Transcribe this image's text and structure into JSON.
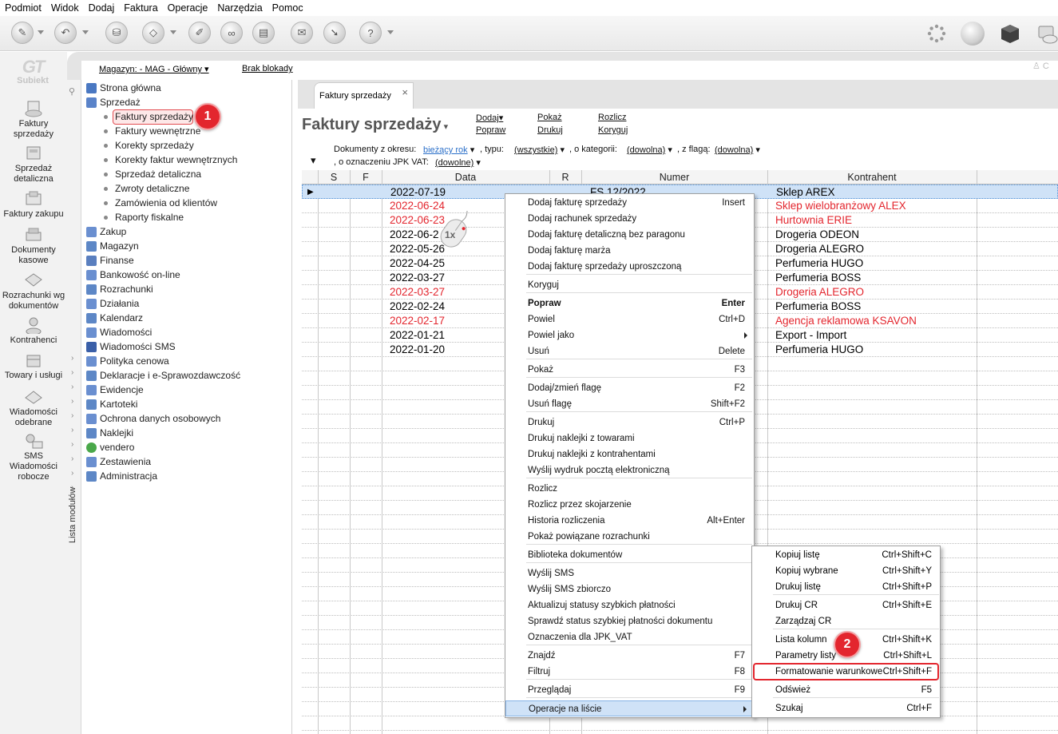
{
  "menubar": [
    "Podmiot",
    "Widok",
    "Dodaj",
    "Faktura",
    "Operacje",
    "Narzędzia",
    "Pomoc"
  ],
  "logo": {
    "mark": "GT",
    "text": "Subiekt"
  },
  "leftbar": [
    {
      "label": "Faktury sprzedaży",
      "icon": "invoices-icon"
    },
    {
      "label": "Sprzedaż detaliczna",
      "icon": "retail-icon"
    },
    {
      "label": "Faktury zakupu",
      "icon": "purchase-icon"
    },
    {
      "label": "Dokumenty kasowe",
      "icon": "cash-docs-icon"
    },
    {
      "label": "Rozrachunki wg dokumentów",
      "icon": "settlements-icon"
    },
    {
      "label": "Kontrahenci",
      "icon": "contractors-icon"
    },
    {
      "label": "Towary i usługi",
      "icon": "goods-icon"
    },
    {
      "label": "Wiadomości odebrane",
      "icon": "messages-icon"
    },
    {
      "label": "SMS Wiadomości robocze",
      "icon": "sms-icon"
    }
  ],
  "header": {
    "warehouse": "Magazyn: - MAG - Główny",
    "lock": "Brak blokady",
    "user_initial": "C"
  },
  "modules_label": "Lista modułów",
  "tree": {
    "items": [
      {
        "label": "Strona główna",
        "color": "#4a78c2"
      },
      {
        "label": "Sprzedaż",
        "color": "#5a83c9"
      }
    ],
    "sales_children": [
      "Faktury sprzedaży",
      "Faktury wewnętrzne",
      "Korekty sprzedaży",
      "Korekty faktur wewnętrznych",
      "Sprzedaż detaliczna",
      "Zwroty detaliczne",
      "Zamówienia od klientów",
      "Raporty fiskalne"
    ],
    "rest": [
      {
        "label": "Zakup",
        "color": "#6a8fd0"
      },
      {
        "label": "Magazyn",
        "color": "#5d87c6"
      },
      {
        "label": "Finanse",
        "color": "#5a7fbf"
      },
      {
        "label": "Bankowość on-line",
        "color": "#6a8fd0"
      },
      {
        "label": "Rozrachunki",
        "color": "#5d87c6"
      },
      {
        "label": "Działania",
        "color": "#6a8fd0"
      },
      {
        "label": "Kalendarz",
        "color": "#5d87c6"
      },
      {
        "label": "Wiadomości",
        "color": "#6a8fd0"
      },
      {
        "label": "Wiadomości SMS",
        "color": "#3a5fa8"
      },
      {
        "label": "Polityka cenowa",
        "color": "#6a8fd0"
      },
      {
        "label": "Deklaracje i e-Sprawozdawczość",
        "color": "#5d87c6"
      },
      {
        "label": "Ewidencje",
        "color": "#6a8fd0"
      },
      {
        "label": "Kartoteki",
        "color": "#5d87c6"
      },
      {
        "label": "Ochrona danych osobowych",
        "color": "#6a8fd0"
      },
      {
        "label": "Naklejki",
        "color": "#5d87c6"
      },
      {
        "label": "vendero",
        "color": "#4aa84a"
      },
      {
        "label": "Zestawienia",
        "color": "#6a8fd0"
      },
      {
        "label": "Administracja",
        "color": "#5d87c6"
      }
    ]
  },
  "badges": {
    "one": "1",
    "two": "2"
  },
  "tab": {
    "label": "Faktury sprzedaży",
    "close": "×"
  },
  "page": {
    "title": "Faktury sprzedaży",
    "actions": [
      "Dodaj",
      "Popraw",
      "Pokaż",
      "Drukuj",
      "Rozlicz",
      "Koryguj"
    ]
  },
  "filters": {
    "period_label": "Dokumenty z okresu:",
    "period_value": "bieżący rok",
    "type_label": ", typu:",
    "type_value": "(wszystkie)",
    "category_label": ", o kategorii:",
    "category_value": "(dowolna)",
    "flag_label": ", z flagą:",
    "flag_value": "(dowolna)",
    "jpk_label": ", o oznaczeniu JPK VAT:",
    "jpk_value": "(dowolne)"
  },
  "columns": [
    "S",
    "F",
    "Data",
    "R",
    "Numer",
    "Kontrahent"
  ],
  "rows": [
    {
      "date": "2022-07-19",
      "number": "FS 12/2022",
      "contractor": "Sklep AREX",
      "red": false
    },
    {
      "date": "2022-06-24",
      "number": "",
      "contractor": "Sklep wielobranżowy  ALEX",
      "red": true
    },
    {
      "date": "2022-06-23",
      "number": "",
      "contractor": "Hurtownia ERIE",
      "red": true
    },
    {
      "date": "2022-06-2",
      "number": "",
      "contractor": "Drogeria ODEON",
      "red": false
    },
    {
      "date": "2022-05-26",
      "number": "",
      "contractor": "Drogeria ALEGRO",
      "red": false
    },
    {
      "date": "2022-04-25",
      "number": "",
      "contractor": "Perfumeria HUGO",
      "red": false
    },
    {
      "date": "2022-03-27",
      "number": "",
      "contractor": "Perfumeria BOSS",
      "red": false
    },
    {
      "date": "2022-03-27",
      "number": "",
      "contractor": "Drogeria ALEGRO",
      "red": true
    },
    {
      "date": "2022-02-24",
      "number": "",
      "contractor": "Perfumeria BOSS",
      "red": false
    },
    {
      "date": "2022-02-17",
      "number": "",
      "contractor": "Agencja reklamowa KSAVON",
      "red": true
    },
    {
      "date": "2022-01-21",
      "number": "",
      "contractor": "Export - Import",
      "red": false
    },
    {
      "date": "2022-01-20",
      "number": "",
      "contractor": "Perfumeria HUGO",
      "red": false
    }
  ],
  "mouse_label": "1x",
  "context_menu": [
    {
      "label": "Dodaj fakturę sprzedaży",
      "shortcut": "Insert"
    },
    {
      "label": "Dodaj rachunek sprzedaży",
      "shortcut": ""
    },
    {
      "label": "Dodaj fakturę detaliczną bez paragonu",
      "shortcut": ""
    },
    {
      "label": "Dodaj fakturę marża",
      "shortcut": ""
    },
    {
      "label": "Dodaj fakturę sprzedaży uproszczoną",
      "shortcut": ""
    },
    {
      "label": "Koryguj",
      "shortcut": ""
    },
    {
      "label": "Popraw",
      "shortcut": "Enter"
    },
    {
      "label": "Powiel",
      "shortcut": "Ctrl+D"
    },
    {
      "label": "Powiel jako",
      "shortcut": ""
    },
    {
      "label": "Usuń",
      "shortcut": "Delete"
    },
    {
      "label": "Pokaż",
      "shortcut": "F3"
    },
    {
      "label": "Dodaj/zmień flagę",
      "shortcut": "F2"
    },
    {
      "label": "Usuń flagę",
      "shortcut": "Shift+F2"
    },
    {
      "label": "Drukuj",
      "shortcut": "Ctrl+P"
    },
    {
      "label": "Drukuj naklejki z towarami",
      "shortcut": ""
    },
    {
      "label": "Drukuj naklejki z kontrahentami",
      "shortcut": ""
    },
    {
      "label": "Wyślij wydruk pocztą elektroniczną",
      "shortcut": ""
    },
    {
      "label": "Rozlicz",
      "shortcut": ""
    },
    {
      "label": "Rozlicz przez skojarzenie",
      "shortcut": ""
    },
    {
      "label": "Historia rozliczenia",
      "shortcut": "Alt+Enter"
    },
    {
      "label": "Pokaż powiązane rozrachunki",
      "shortcut": ""
    },
    {
      "label": "Biblioteka dokumentów",
      "shortcut": ""
    },
    {
      "label": "Wyślij SMS",
      "shortcut": ""
    },
    {
      "label": "Wyślij SMS zbiorczo",
      "shortcut": ""
    },
    {
      "label": "Aktualizuj statusy szybkich płatności",
      "shortcut": ""
    },
    {
      "label": "Sprawdź status szybkiej płatności dokumentu",
      "shortcut": ""
    },
    {
      "label": "Oznaczenia dla JPK_VAT",
      "shortcut": ""
    },
    {
      "label": "Znajdź",
      "shortcut": "F7"
    },
    {
      "label": "Filtruj",
      "shortcut": "F8"
    },
    {
      "label": "Przeglądaj",
      "shortcut": "F9"
    },
    {
      "label": "Operacje na liście",
      "shortcut": ""
    }
  ],
  "submenu": [
    {
      "label": "Kopiuj listę",
      "shortcut": "Ctrl+Shift+C"
    },
    {
      "label": "Kopiuj wybrane",
      "shortcut": "Ctrl+Shift+Y"
    },
    {
      "label": "Drukuj listę",
      "shortcut": "Ctrl+Shift+P"
    },
    {
      "label": "Drukuj CR",
      "shortcut": "Ctrl+Shift+E"
    },
    {
      "label": "Zarządzaj CR",
      "shortcut": ""
    },
    {
      "label": "Lista kolumn",
      "shortcut": "Ctrl+Shift+K"
    },
    {
      "label": "Parametry listy",
      "shortcut": "Ctrl+Shift+L"
    },
    {
      "label": "Formatowanie warunkowe",
      "shortcut": "Ctrl+Shift+F"
    },
    {
      "label": "Odśwież",
      "shortcut": "F5"
    },
    {
      "label": "Szukaj",
      "shortcut": "Ctrl+F"
    }
  ],
  "colors": {
    "accent_red": "#e3262e",
    "selection": "#cfe2f7",
    "link_blue": "#2a6fc9"
  }
}
